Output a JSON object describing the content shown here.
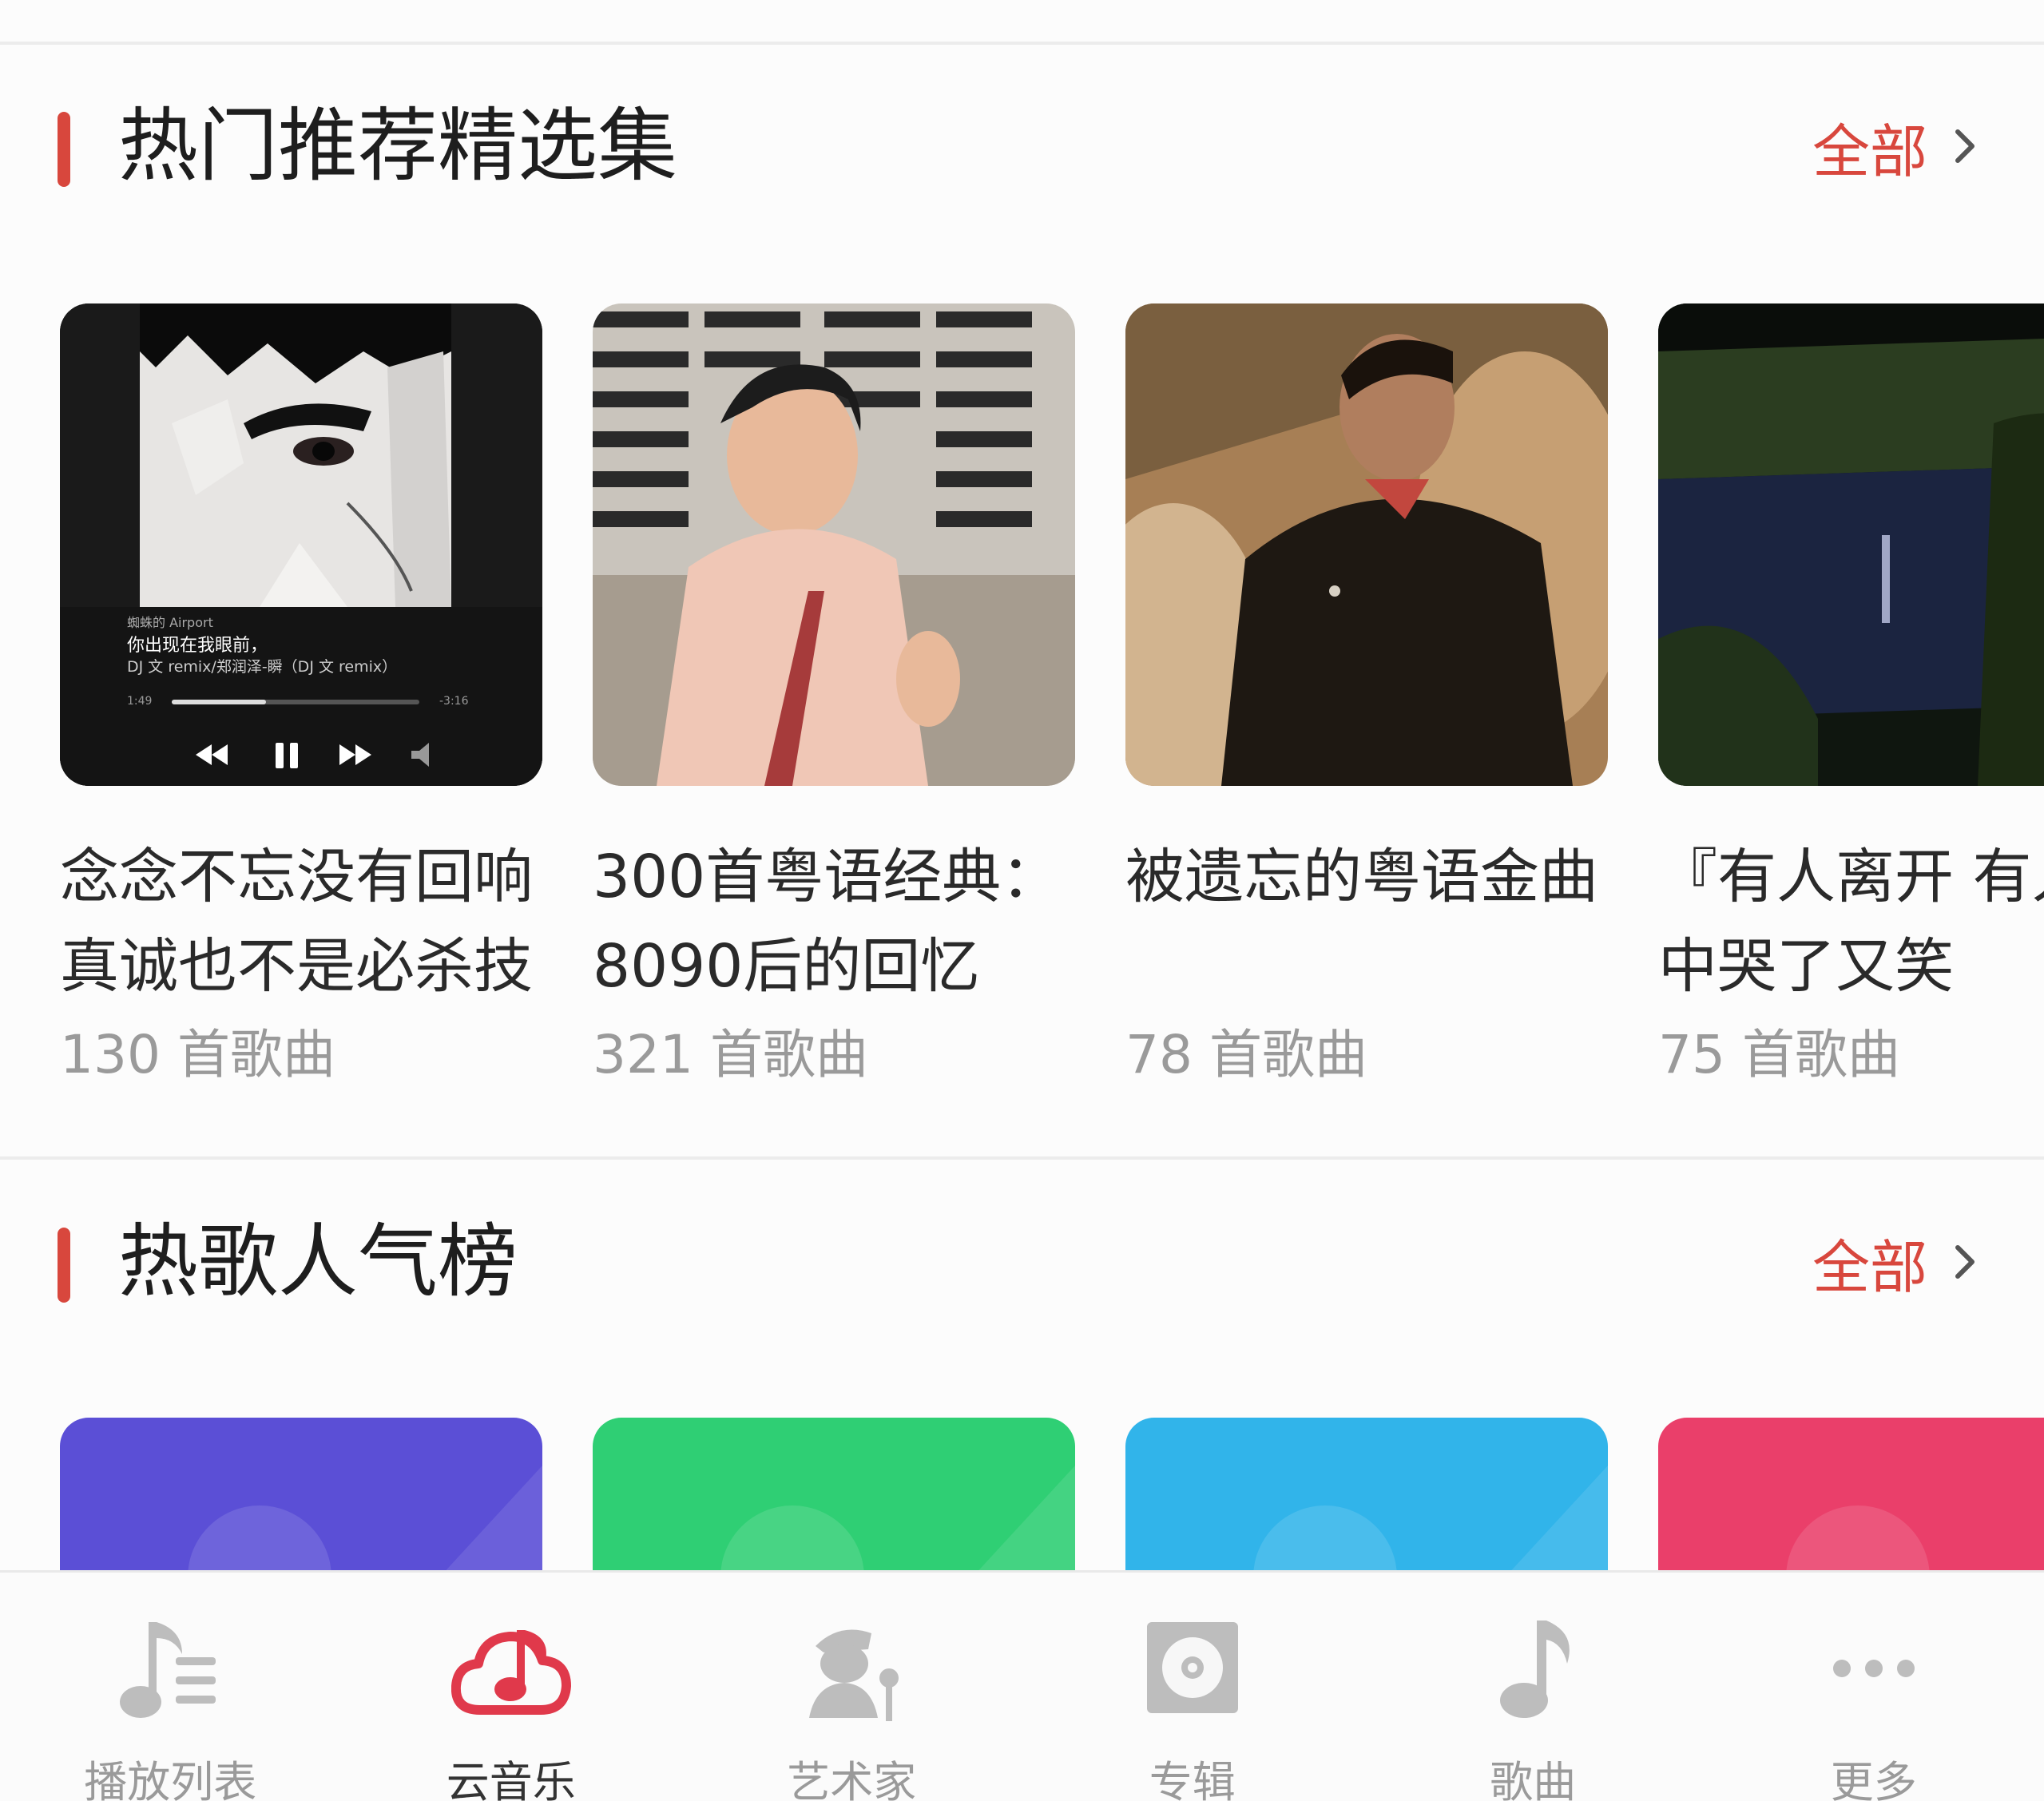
{
  "colors": {
    "accent": "#d8473d",
    "nav_inactive": "#bdbdbd",
    "nav_active": "#e0394b",
    "chart_purple": "#5b4fd6",
    "chart_green": "#2fcf74",
    "chart_blue": "#31b4ea",
    "chart_red": "#ea3f6a"
  },
  "featured": {
    "title": "热门推荐精选集",
    "see_all": "全部",
    "cards": [
      {
        "title": "念念不忘没有回响 真诚也不是必杀技",
        "count": "130 首歌曲",
        "cover": {
          "subtitle": "蜘蛛的 Airport",
          "lyric": "你出现在我眼前，",
          "track": "DJ 文 remix/郑润泽-瞬（DJ 文 remix）",
          "elapsed": "1:49",
          "remaining": "-3:16",
          "progress": 0.38
        }
      },
      {
        "title": "300首粤语经典：8090后的回忆",
        "count": "321 首歌曲"
      },
      {
        "title": "被遗忘的粤语金曲",
        "count": "78 首歌曲"
      },
      {
        "title": "『有人离开 有人在雨中哭了又笑",
        "count": "75 首歌曲"
      }
    ]
  },
  "charts": {
    "title": "热歌人气榜",
    "see_all": "全部"
  },
  "nav": {
    "items": [
      {
        "label": "播放列表",
        "icon": "playlist-icon",
        "active": false
      },
      {
        "label": "云音乐",
        "icon": "cloud-music-icon",
        "active": true
      },
      {
        "label": "艺术家",
        "icon": "artist-icon",
        "active": false
      },
      {
        "label": "专辑",
        "icon": "album-icon",
        "active": false
      },
      {
        "label": "歌曲",
        "icon": "music-note-icon",
        "active": false
      },
      {
        "label": "更多",
        "icon": "more-icon",
        "active": false
      }
    ]
  }
}
